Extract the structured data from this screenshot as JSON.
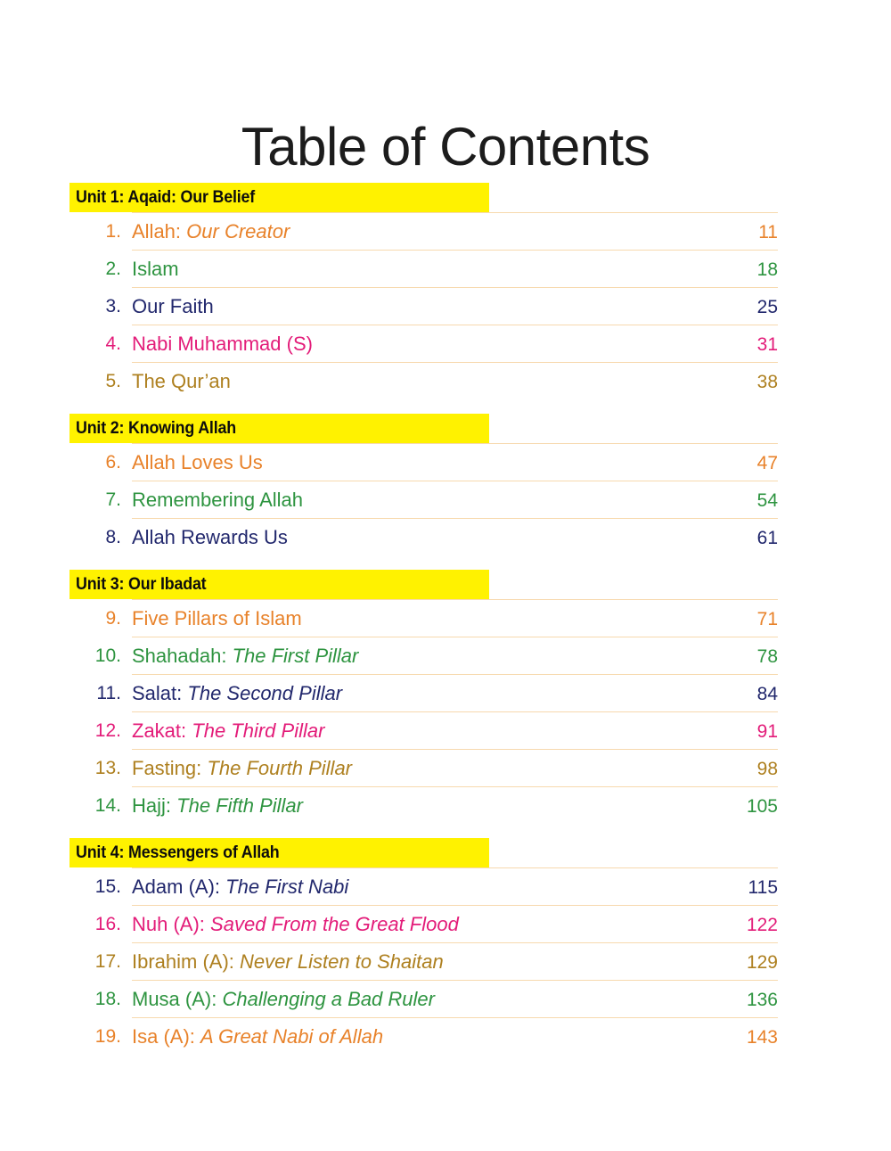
{
  "document": {
    "title": "Table of Contents",
    "highlight_color": "#FFF200",
    "rule_color": "#F7D9AE",
    "palette": {
      "orange": "#E8822A",
      "green": "#2E9440",
      "navy": "#22286D",
      "magenta": "#E31C79",
      "gold": "#AE8020"
    }
  },
  "units": [
    {
      "header": "Unit 1: Aqaid: Our Belief",
      "entries": [
        {
          "num": "1.",
          "title_main": "Allah:",
          "title_sub": "Our Creator",
          "page": "11",
          "color": "orange"
        },
        {
          "num": "2.",
          "title_main": "Islam",
          "title_sub": "",
          "page": "18",
          "color": "green"
        },
        {
          "num": "3.",
          "title_main": "Our Faith",
          "title_sub": "",
          "page": "25",
          "color": "navy"
        },
        {
          "num": "4.",
          "title_main": "Nabi Muhammad (S)",
          "title_sub": "",
          "page": "31",
          "color": "magenta"
        },
        {
          "num": "5.",
          "title_main": "The Qur’an",
          "title_sub": "",
          "page": "38",
          "color": "gold"
        }
      ]
    },
    {
      "header": "Unit 2: Knowing Allah",
      "entries": [
        {
          "num": "6.",
          "title_main": "Allah Loves Us",
          "title_sub": "",
          "page": "47",
          "color": "orange"
        },
        {
          "num": "7.",
          "title_main": "Remembering Allah",
          "title_sub": "",
          "page": "54",
          "color": "green"
        },
        {
          "num": "8.",
          "title_main": "Allah Rewards Us",
          "title_sub": "",
          "page": "61",
          "color": "navy"
        }
      ]
    },
    {
      "header": "Unit 3: Our Ibadat",
      "entries": [
        {
          "num": "9.",
          "title_main": "Five Pillars of Islam",
          "title_sub": "",
          "page": "71",
          "color": "orange"
        },
        {
          "num": "10.",
          "title_main": "Shahadah:",
          "title_sub": "The First Pillar",
          "page": "78",
          "color": "green"
        },
        {
          "num": "11.",
          "title_main": "Salat:",
          "title_sub": "The Second Pillar",
          "page": "84",
          "color": "navy"
        },
        {
          "num": "12.",
          "title_main": "Zakat:",
          "title_sub": "The Third Pillar",
          "page": "91",
          "color": "magenta"
        },
        {
          "num": "13.",
          "title_main": "Fasting:",
          "title_sub": "The Fourth Pillar",
          "page": "98",
          "color": "gold"
        },
        {
          "num": "14.",
          "title_main": "Hajj:",
          "title_sub": "The Fifth Pillar",
          "page": "105",
          "color": "green"
        }
      ]
    },
    {
      "header": "Unit 4: Messengers of Allah",
      "entries": [
        {
          "num": "15.",
          "title_main": "Adam (A):",
          "title_sub": "The First Nabi",
          "page": "115",
          "color": "navy"
        },
        {
          "num": "16.",
          "title_main": "Nuh (A):",
          "title_sub": "Saved From the Great Flood",
          "page": "122",
          "color": "magenta"
        },
        {
          "num": "17.",
          "title_main": "Ibrahim (A):",
          "title_sub": "Never Listen to Shaitan",
          "page": "129",
          "color": "gold"
        },
        {
          "num": "18.",
          "title_main": "Musa (A):",
          "title_sub": "Challenging a Bad Ruler",
          "page": "136",
          "color": "green"
        },
        {
          "num": "19.",
          "title_main": "Isa (A):",
          "title_sub": "A Great Nabi of Allah",
          "page": "143",
          "color": "orange"
        }
      ]
    }
  ]
}
